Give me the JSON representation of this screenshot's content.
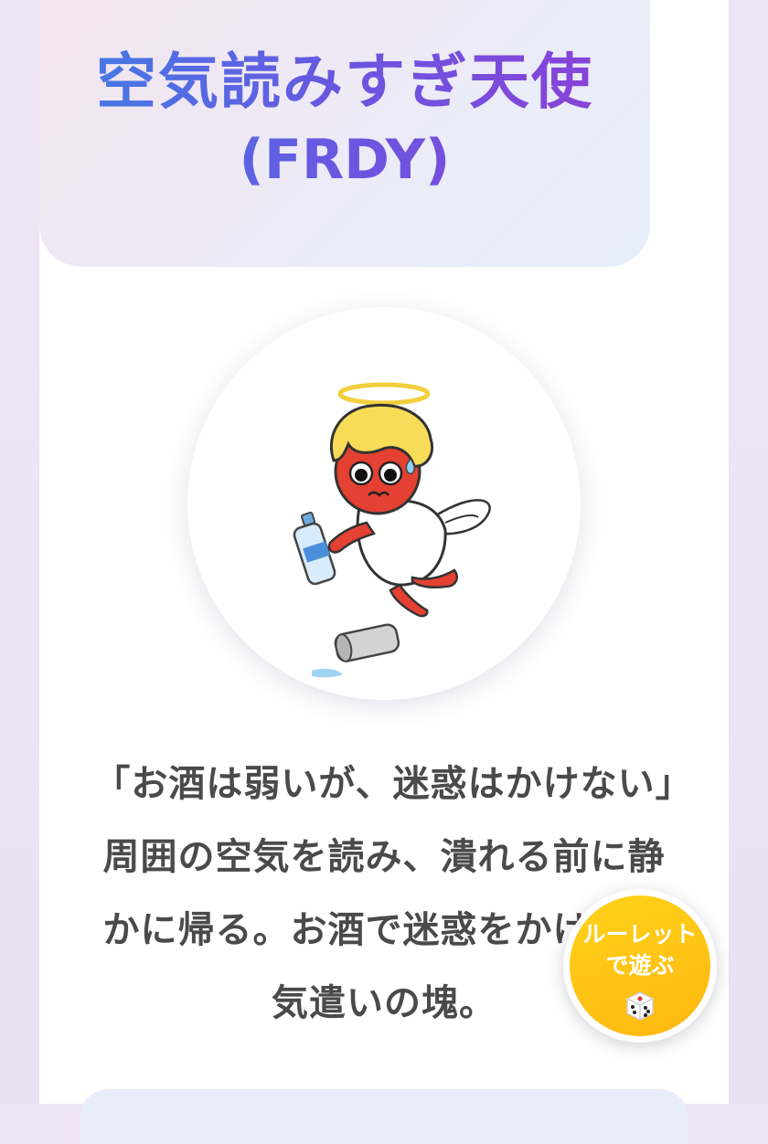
{
  "header": {
    "title_ja": "空気読みすぎ天使",
    "title_code": "(FRDY)"
  },
  "result": {
    "image_alt": "angel-character-illustration",
    "description": "「お酒は弱いが、迷惑はかけない」周囲の空気を読み、潰れる前に静かに帰る。お酒で迷惑をかけない気遣いの塊。"
  },
  "fab": {
    "label": "ルーレットで遊ぶ",
    "icon": "dice-icon",
    "color": "#ffc21a"
  },
  "colors": {
    "title_gradient_start": "#3f7fe6",
    "title_gradient_end": "#8e3fd6",
    "text": "#4a4a4a"
  }
}
